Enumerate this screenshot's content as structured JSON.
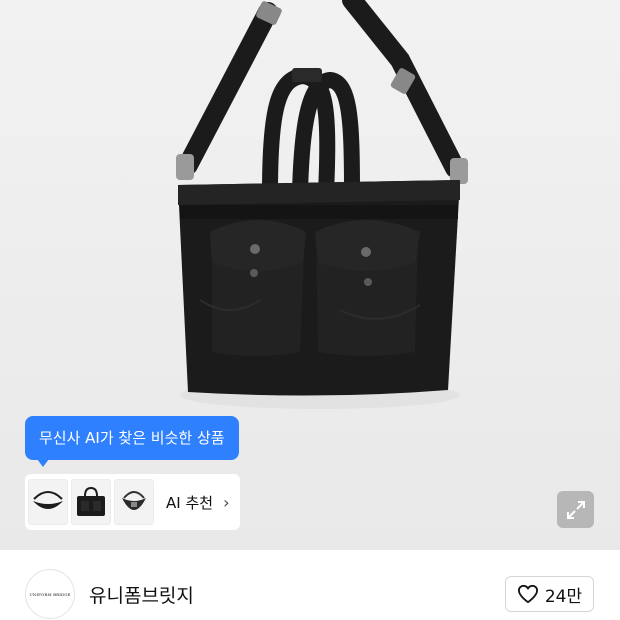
{
  "product_image": {
    "alt": "black tote bag"
  },
  "ai_recommend": {
    "tooltip": "무신사 AI가 찾은 비슷한 상품",
    "label": "AI 추천",
    "chevron": "›",
    "thumbnails": [
      "shoulder-bag-thumb",
      "tote-bag-thumb",
      "hobo-bag-thumb"
    ]
  },
  "expand": {
    "icon": "expand-icon"
  },
  "brand": {
    "logo_text": "UNIFORM BRIDGE",
    "name": "유니폼브릿지"
  },
  "like": {
    "icon": "heart-icon",
    "count": "24만"
  },
  "colors": {
    "accent": "#2f80ff",
    "bag": "#1b1b1b",
    "background": "#eeeeee"
  }
}
